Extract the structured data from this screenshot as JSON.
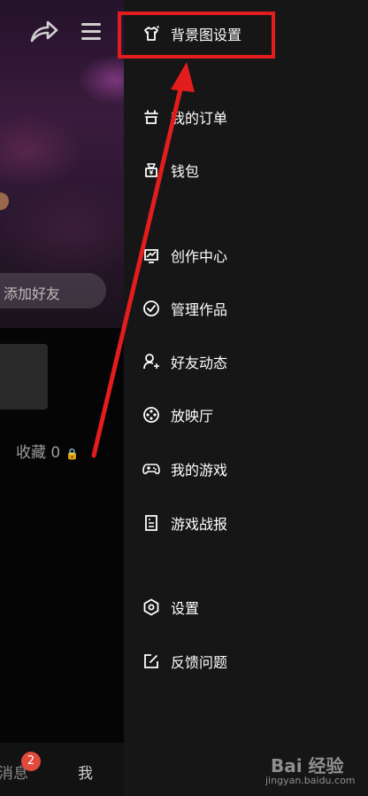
{
  "background_page": {
    "add_friend_label": "添加好友",
    "favorites_label": "收藏 0",
    "tabs": {
      "messages": "消息",
      "me": "我"
    },
    "message_badge": "2"
  },
  "drawer": {
    "items": [
      {
        "label": "背景图设置",
        "icon": "tshirt-icon"
      },
      {
        "label": "我的订单",
        "icon": "order-icon"
      },
      {
        "label": "钱包",
        "icon": "wallet-icon"
      },
      {
        "label": "创作中心",
        "icon": "creation-icon"
      },
      {
        "label": "管理作品",
        "icon": "check-circle-icon"
      },
      {
        "label": "好友动态",
        "icon": "friend-feed-icon"
      },
      {
        "label": "放映厅",
        "icon": "film-reel-icon"
      },
      {
        "label": "我的游戏",
        "icon": "gamepad-icon"
      },
      {
        "label": "游戏战报",
        "icon": "report-icon"
      },
      {
        "label": "设置",
        "icon": "settings-hexagon-icon"
      },
      {
        "label": "反馈问题",
        "icon": "edit-square-icon"
      }
    ]
  },
  "watermark": {
    "brand": "Bai 经验",
    "url": "jingyan.baidu.com"
  },
  "colors": {
    "drawer_bg": "#161616",
    "annotation_red": "#e31d1d",
    "badge_red": "#e0493b"
  }
}
